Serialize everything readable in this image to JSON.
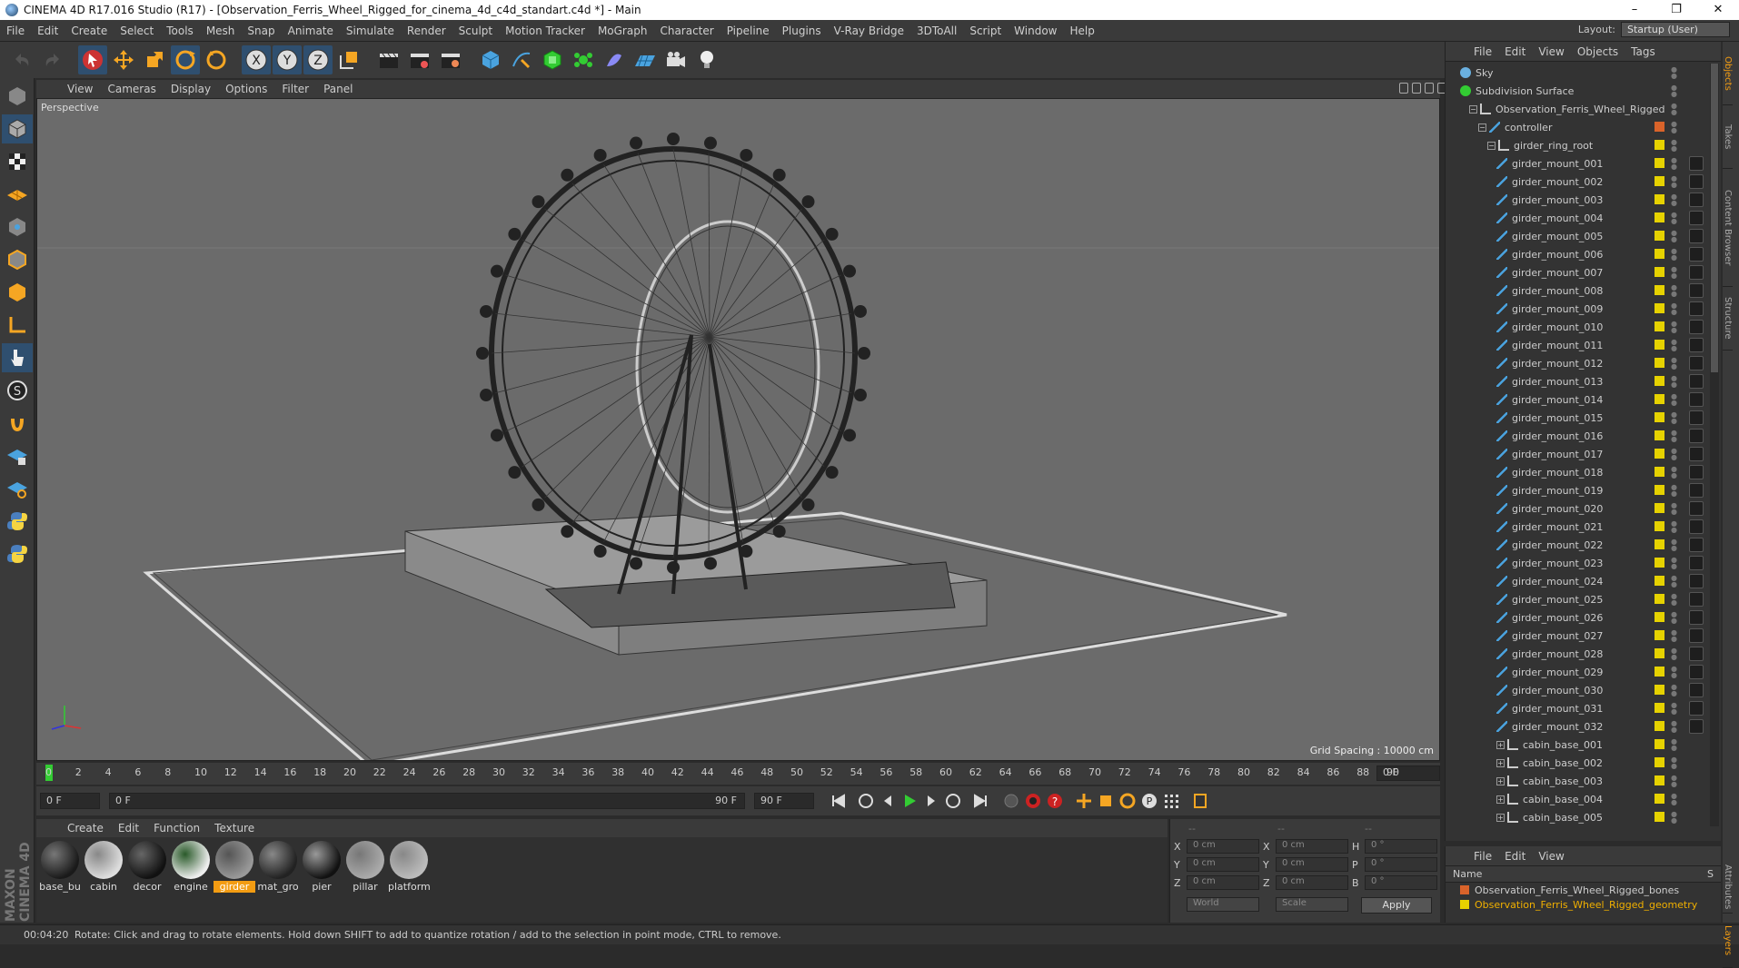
{
  "window": {
    "title": "CINEMA 4D R17.016 Studio (R17) - [Observation_Ferris_Wheel_Rigged_for_cinema_4d_c4d_standart.c4d *] - Main",
    "min": "–",
    "max": "❐",
    "close": "✕"
  },
  "menu": [
    "File",
    "Edit",
    "Create",
    "Select",
    "Tools",
    "Mesh",
    "Snap",
    "Animate",
    "Simulate",
    "Render",
    "Sculpt",
    "Motion Tracker",
    "MoGraph",
    "Character",
    "Pipeline",
    "Plugins",
    "V-Ray Bridge",
    "3DToAll",
    "Script",
    "Window",
    "Help"
  ],
  "layout": {
    "label": "Layout:",
    "value": "Startup (User)"
  },
  "viewport": {
    "menu": [
      "View",
      "Cameras",
      "Display",
      "Options",
      "Filter",
      "Panel"
    ],
    "camera": "Perspective",
    "grid_spacing": "Grid Spacing : 10000 cm"
  },
  "timeline": {
    "ticks": [
      "0",
      "2",
      "4",
      "6",
      "8",
      "10",
      "12",
      "14",
      "16",
      "18",
      "20",
      "22",
      "24",
      "26",
      "28",
      "30",
      "32",
      "34",
      "36",
      "38",
      "40",
      "42",
      "44",
      "46",
      "48",
      "50",
      "52",
      "54",
      "56",
      "58",
      "60",
      "62",
      "64",
      "66",
      "68",
      "70",
      "72",
      "74",
      "76",
      "78",
      "80",
      "82",
      "84",
      "86",
      "88",
      "90"
    ],
    "current": "0 F"
  },
  "transport": {
    "start": "0 F",
    "range_start": "0 F",
    "range_end": "90 F",
    "end": "90 F"
  },
  "materials": {
    "menu": [
      "Create",
      "Edit",
      "Function",
      "Texture"
    ],
    "items": [
      {
        "name": "base_bu",
        "a": "#1a1a1a",
        "b": "#777"
      },
      {
        "name": "cabin",
        "a": "#ddd",
        "b": "#888"
      },
      {
        "name": "decor",
        "a": "#111",
        "b": "#666"
      },
      {
        "name": "engine",
        "a": "#eee",
        "b": "#2a5a2a"
      },
      {
        "name": "girder",
        "a": "#999",
        "b": "#555"
      },
      {
        "name": "mat_gro",
        "a": "#222",
        "b": "#888"
      },
      {
        "name": "pier",
        "a": "#111",
        "b": "#999"
      },
      {
        "name": "pillar",
        "a": "#aaa",
        "b": "#777"
      },
      {
        "name": "platform",
        "a": "#bbb",
        "b": "#888"
      }
    ],
    "selected": "girder"
  },
  "coords": {
    "hdr": [
      "--",
      "--",
      "--"
    ],
    "x": "X",
    "y": "Y",
    "z": "Z",
    "h": "H",
    "p": "P",
    "b": "B",
    "val": "0 cm",
    "rot": "0 °",
    "space": "World",
    "mode": "Scale",
    "apply": "Apply"
  },
  "status": {
    "time": "00:04:20",
    "msg": "Rotate: Click and drag to rotate elements. Hold down SHIFT to add to quantize rotation / add to the selection in point mode, CTRL to remove."
  },
  "objects": {
    "menu": [
      "File",
      "Edit",
      "View",
      "Objects",
      "Tags"
    ],
    "rows": [
      {
        "label": "Sky",
        "indent": 0,
        "icon": "sky",
        "tag": false
      },
      {
        "label": "Subdivision Surface",
        "indent": 0,
        "icon": "subd",
        "tag": false
      },
      {
        "label": "Observation_Ferris_Wheel_Rigged",
        "indent": 1,
        "icon": "null",
        "tag": false
      },
      {
        "label": "controller",
        "indent": 2,
        "icon": "joint",
        "tag": "orange"
      },
      {
        "label": "girder_ring_root",
        "indent": 3,
        "icon": "null",
        "tag": "yellow"
      },
      {
        "label": "girder_mount_001",
        "indent": 4,
        "icon": "joint",
        "tag": "yellow"
      },
      {
        "label": "girder_mount_002",
        "indent": 4,
        "icon": "joint",
        "tag": "yellow"
      },
      {
        "label": "girder_mount_003",
        "indent": 4,
        "icon": "joint",
        "tag": "yellow"
      },
      {
        "label": "girder_mount_004",
        "indent": 4,
        "icon": "joint",
        "tag": "yellow"
      },
      {
        "label": "girder_mount_005",
        "indent": 4,
        "icon": "joint",
        "tag": "yellow"
      },
      {
        "label": "girder_mount_006",
        "indent": 4,
        "icon": "joint",
        "tag": "yellow"
      },
      {
        "label": "girder_mount_007",
        "indent": 4,
        "icon": "joint",
        "tag": "yellow"
      },
      {
        "label": "girder_mount_008",
        "indent": 4,
        "icon": "joint",
        "tag": "yellow"
      },
      {
        "label": "girder_mount_009",
        "indent": 4,
        "icon": "joint",
        "tag": "yellow"
      },
      {
        "label": "girder_mount_010",
        "indent": 4,
        "icon": "joint",
        "tag": "yellow"
      },
      {
        "label": "girder_mount_011",
        "indent": 4,
        "icon": "joint",
        "tag": "yellow"
      },
      {
        "label": "girder_mount_012",
        "indent": 4,
        "icon": "joint",
        "tag": "yellow"
      },
      {
        "label": "girder_mount_013",
        "indent": 4,
        "icon": "joint",
        "tag": "yellow"
      },
      {
        "label": "girder_mount_014",
        "indent": 4,
        "icon": "joint",
        "tag": "yellow"
      },
      {
        "label": "girder_mount_015",
        "indent": 4,
        "icon": "joint",
        "tag": "yellow"
      },
      {
        "label": "girder_mount_016",
        "indent": 4,
        "icon": "joint",
        "tag": "yellow"
      },
      {
        "label": "girder_mount_017",
        "indent": 4,
        "icon": "joint",
        "tag": "yellow"
      },
      {
        "label": "girder_mount_018",
        "indent": 4,
        "icon": "joint",
        "tag": "yellow"
      },
      {
        "label": "girder_mount_019",
        "indent": 4,
        "icon": "joint",
        "tag": "yellow"
      },
      {
        "label": "girder_mount_020",
        "indent": 4,
        "icon": "joint",
        "tag": "yellow"
      },
      {
        "label": "girder_mount_021",
        "indent": 4,
        "icon": "joint",
        "tag": "yellow"
      },
      {
        "label": "girder_mount_022",
        "indent": 4,
        "icon": "joint",
        "tag": "yellow"
      },
      {
        "label": "girder_mount_023",
        "indent": 4,
        "icon": "joint",
        "tag": "yellow"
      },
      {
        "label": "girder_mount_024",
        "indent": 4,
        "icon": "joint",
        "tag": "yellow"
      },
      {
        "label": "girder_mount_025",
        "indent": 4,
        "icon": "joint",
        "tag": "yellow"
      },
      {
        "label": "girder_mount_026",
        "indent": 4,
        "icon": "joint",
        "tag": "yellow"
      },
      {
        "label": "girder_mount_027",
        "indent": 4,
        "icon": "joint",
        "tag": "yellow"
      },
      {
        "label": "girder_mount_028",
        "indent": 4,
        "icon": "joint",
        "tag": "yellow"
      },
      {
        "label": "girder_mount_029",
        "indent": 4,
        "icon": "joint",
        "tag": "yellow"
      },
      {
        "label": "girder_mount_030",
        "indent": 4,
        "icon": "joint",
        "tag": "yellow"
      },
      {
        "label": "girder_mount_031",
        "indent": 4,
        "icon": "joint",
        "tag": "yellow"
      },
      {
        "label": "girder_mount_032",
        "indent": 4,
        "icon": "joint",
        "tag": "yellow"
      },
      {
        "label": "cabin_base_001",
        "indent": 4,
        "icon": "null",
        "tag": "yellow"
      },
      {
        "label": "cabin_base_002",
        "indent": 4,
        "icon": "null",
        "tag": "yellow"
      },
      {
        "label": "cabin_base_003",
        "indent": 4,
        "icon": "null",
        "tag": "yellow"
      },
      {
        "label": "cabin_base_004",
        "indent": 4,
        "icon": "null",
        "tag": "yellow"
      },
      {
        "label": "cabin_base_005",
        "indent": 4,
        "icon": "null",
        "tag": "yellow"
      }
    ]
  },
  "layers": {
    "menu": [
      "File",
      "Edit",
      "View"
    ],
    "name_col": "Name",
    "s_col": "S",
    "rows": [
      {
        "label": "Observation_Ferris_Wheel_Rigged_bones",
        "color": "#d9632a",
        "text": "#ccc"
      },
      {
        "label": "Observation_Ferris_Wheel_Rigged_geometry",
        "color": "#e6d200",
        "text": "#f0b000"
      }
    ]
  },
  "sidetabs": [
    "Objects",
    "Takes",
    "Content Browser",
    "Structure"
  ],
  "sidetabs_lower": [
    "Attributes",
    "Layers"
  ]
}
